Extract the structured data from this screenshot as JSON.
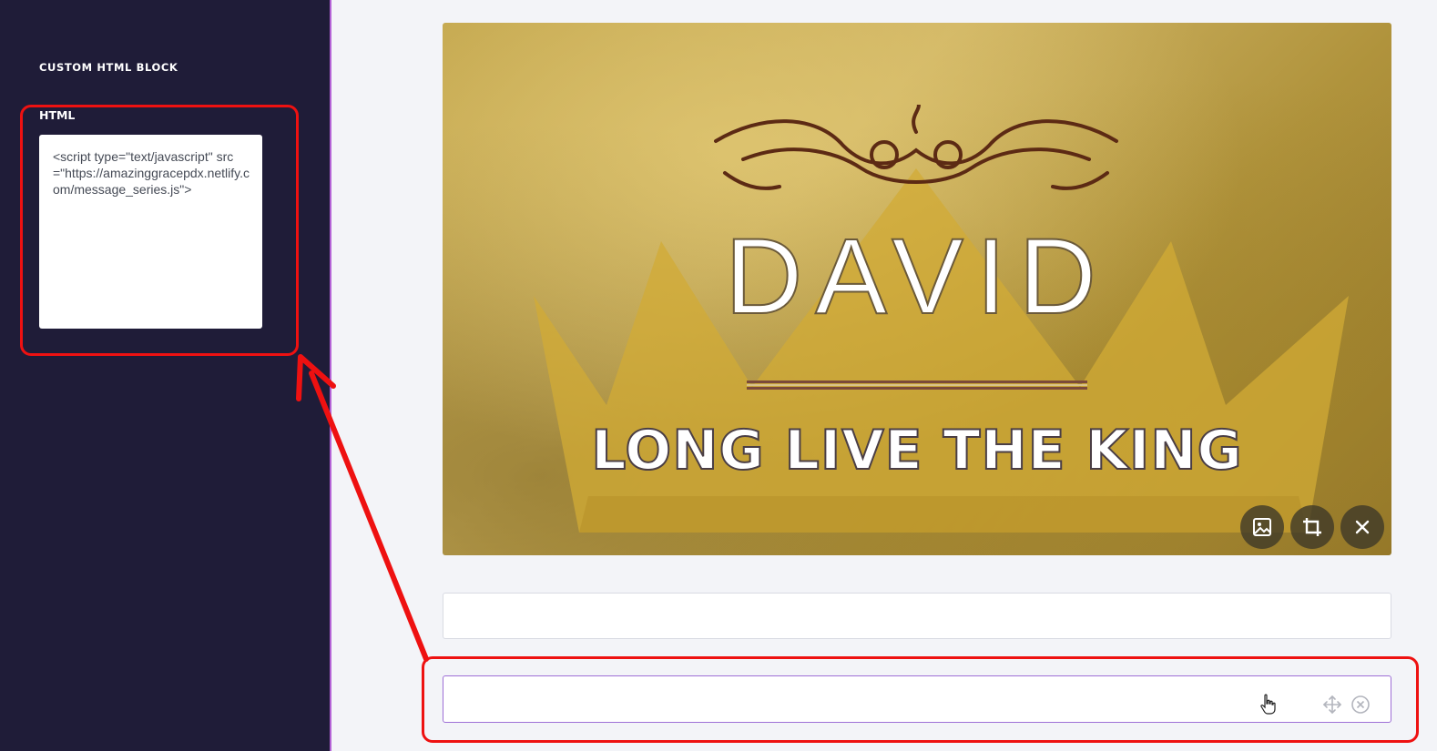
{
  "sidebar": {
    "title": "CUSTOM HTML BLOCK",
    "field_label": "HTML",
    "html_value": "<script type=\"text/javascript\" src=\"https://amazinggracepdx.netlify.com/message_series.js\">"
  },
  "banner": {
    "title": "DAVID",
    "subtitle": "LONG LIVE THE KING",
    "buttons": {
      "image_icon": "image-icon",
      "crop_icon": "crop-icon",
      "close_icon": "close-icon"
    }
  },
  "blocks": {
    "text_block_value": "",
    "html_block_icons": [
      "move-icon",
      "remove-circle-icon"
    ]
  },
  "colors": {
    "sidebar_bg": "#1f1c38",
    "sidebar_border": "#b463d6",
    "annotation_red": "#ee1111",
    "selected_block_border": "#9e6fd6"
  }
}
